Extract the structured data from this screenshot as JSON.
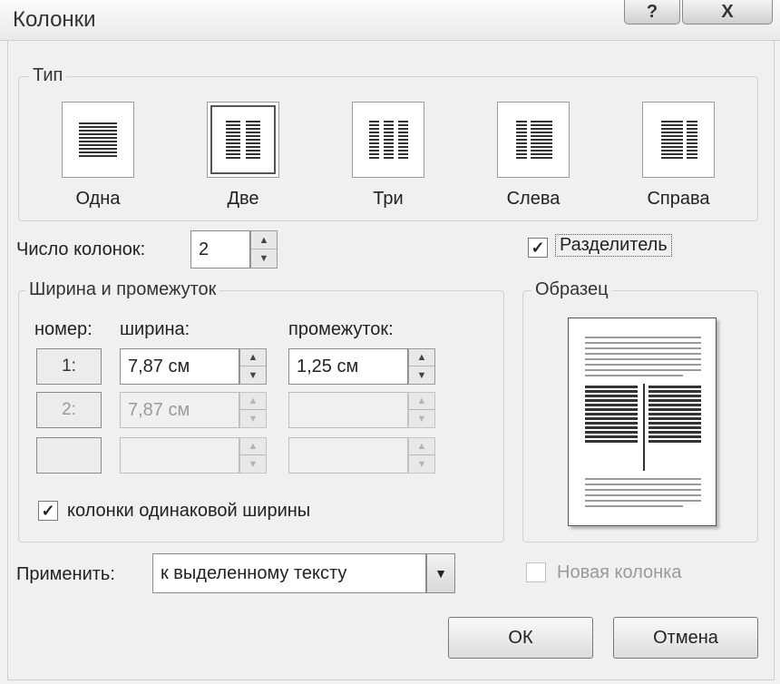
{
  "window": {
    "title": "Колонки",
    "help_label": "?",
    "close_label": "X"
  },
  "type_group": {
    "legend": "Тип",
    "presets": [
      {
        "label": "Одна",
        "selected": false
      },
      {
        "label": "Две",
        "selected": true
      },
      {
        "label": "Три",
        "selected": false
      },
      {
        "label": "Слева",
        "selected": false
      },
      {
        "label": "Справа",
        "selected": false
      }
    ]
  },
  "columns_count": {
    "label": "Число колонок:",
    "value": "2"
  },
  "separator": {
    "label": "Разделитель",
    "checked": true
  },
  "width_group": {
    "legend": "Ширина и промежуток",
    "headers": {
      "number": "номер:",
      "width": "ширина:",
      "spacing": "промежуток:"
    },
    "rows": [
      {
        "number": "1:",
        "width": "7,87 см",
        "spacing": "1,25 см",
        "enabled": true
      },
      {
        "number": "2:",
        "width": "7,87 см",
        "spacing": "",
        "enabled": false
      },
      {
        "number": "",
        "width": "",
        "spacing": "",
        "enabled": false
      }
    ],
    "equal_width": {
      "label": "колонки одинаковой ширины",
      "checked": true
    }
  },
  "sample": {
    "legend": "Образец"
  },
  "apply": {
    "label": "Применить:",
    "value": "к выделенному тексту"
  },
  "new_column": {
    "label": "Новая колонка",
    "checked": false
  },
  "buttons": {
    "ok": "ОК",
    "cancel": "Отмена"
  },
  "icons": {
    "check": "✓",
    "up": "▲",
    "down": "▼"
  }
}
